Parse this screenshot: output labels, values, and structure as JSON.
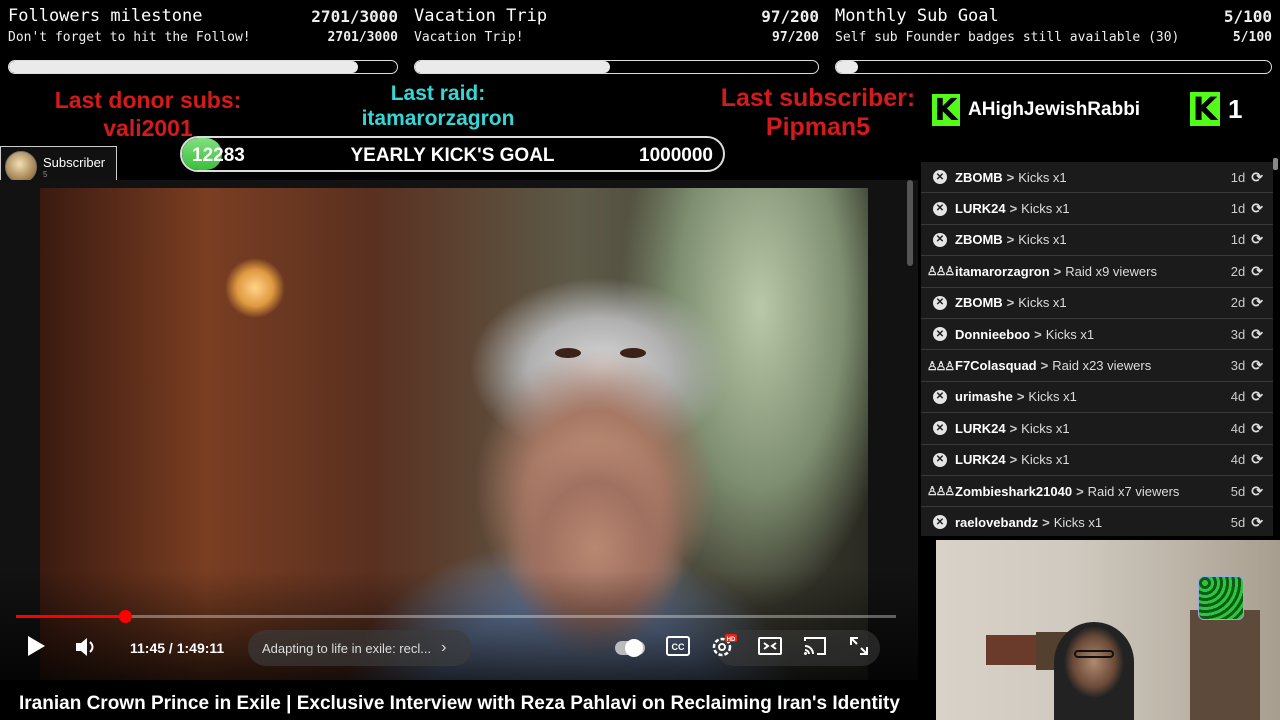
{
  "goals": [
    {
      "title": "Followers milestone",
      "count": "2701/3000",
      "subtitle": "Don't forget to hit the Follow!",
      "sub_count": "2701/3000",
      "progress": 0.9
    },
    {
      "title": "Vacation Trip",
      "count": "97/200",
      "subtitle": "Vacation Trip!",
      "sub_count": "97/200",
      "progress": 0.485
    },
    {
      "title": "Monthly Sub Goal",
      "count": "5/100",
      "subtitle": "Self sub Founder badges still available (30)",
      "sub_count": "5/100",
      "progress": 0.05
    }
  ],
  "alerts": {
    "donor_label": "Last donor subs:",
    "donor_name": "vali2001",
    "raid_label": "Last raid:",
    "raid_name": "itamarorzagron",
    "subscriber_label": "Last subscriber:",
    "subscriber_name": "Pipman5"
  },
  "kick": {
    "logo": "K",
    "top_user": "AHighJewishRabbi",
    "count": "1"
  },
  "yearly_goal": {
    "current": "12283",
    "title": "YEARLY KICK'S GOAL",
    "target": "1000000",
    "progress": 0.012
  },
  "subscriber_card": {
    "label": "Subscriber",
    "small": "5"
  },
  "video": {
    "time": "11:45 / 1:49:11",
    "chapter": "Adapting to life in exile: recl...",
    "title": "Iranian Crown Prince in Exile | Exclusive Interview with Reza Pahlavi on Reclaiming Iran's Identity",
    "played_fraction": 0.124,
    "icons": [
      "play-icon",
      "volume-icon",
      "autoplay-toggle",
      "captions-icon",
      "settings-icon",
      "theater-icon",
      "cast-icon",
      "fullscreen-icon"
    ],
    "hd_badge": "HD",
    "cc_label": "CC"
  },
  "events": [
    {
      "icon": "kick-icon",
      "user": "ZBOMB",
      "desc": "Kicks x1",
      "age": "1d"
    },
    {
      "icon": "kick-icon",
      "user": "LURK24",
      "desc": "Kicks x1",
      "age": "1d"
    },
    {
      "icon": "kick-icon",
      "user": "ZBOMB",
      "desc": "Kicks x1",
      "age": "1d"
    },
    {
      "icon": "raid-icon",
      "user": "itamarorzagron",
      "desc": "Raid x9 viewers",
      "age": "2d"
    },
    {
      "icon": "kick-icon",
      "user": "ZBOMB",
      "desc": "Kicks x1",
      "age": "2d"
    },
    {
      "icon": "kick-icon",
      "user": "Donnieeboo",
      "desc": "Kicks x1",
      "age": "3d"
    },
    {
      "icon": "raid-icon",
      "user": "F7Colasquad",
      "desc": "Raid x23 viewers",
      "age": "3d"
    },
    {
      "icon": "kick-icon",
      "user": "urimashe",
      "desc": "Kicks x1",
      "age": "4d"
    },
    {
      "icon": "kick-icon",
      "user": "LURK24",
      "desc": "Kicks x1",
      "age": "4d"
    },
    {
      "icon": "kick-icon",
      "user": "LURK24",
      "desc": "Kicks x1",
      "age": "4d"
    },
    {
      "icon": "raid-icon",
      "user": "Zombieshark21040",
      "desc": "Raid x7 viewers",
      "age": "5d"
    },
    {
      "icon": "kick-icon",
      "user": "raelovebandz",
      "desc": "Kicks x1",
      "age": "5d"
    }
  ],
  "colors": {
    "alert_red": "#d41a1a",
    "alert_cyan": "#35d7d6",
    "kick_green": "#53fc18",
    "progress_red": "#ff0000"
  }
}
